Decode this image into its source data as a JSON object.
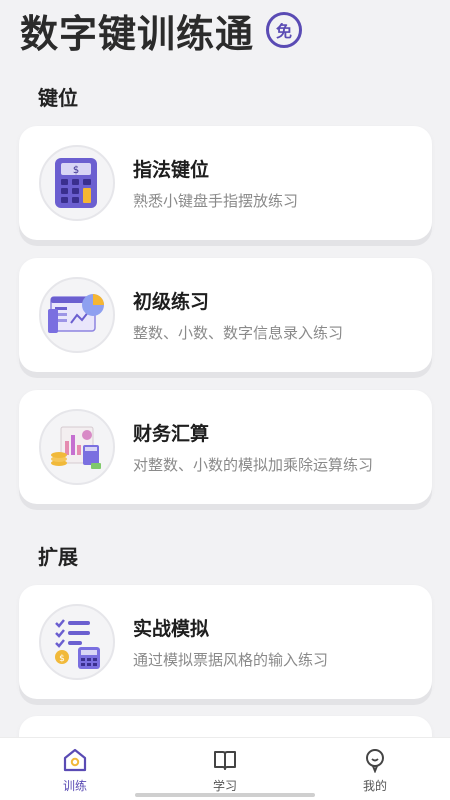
{
  "header": {
    "title": "数字键训练通",
    "badge": "免"
  },
  "sections": [
    {
      "title": "键位"
    },
    {
      "title": "扩展"
    }
  ],
  "cards": [
    {
      "title": "指法键位",
      "subtitle": "熟悉小键盘手指摆放练习",
      "icon": "calculator-icon"
    },
    {
      "title": "初级练习",
      "subtitle": "整数、小数、数字信息录入练习",
      "icon": "chart-dashboard-icon"
    },
    {
      "title": "财务汇算",
      "subtitle": "对整数、小数的模拟加乘除运算练习",
      "icon": "finance-coins-icon"
    },
    {
      "title": "实战模拟",
      "subtitle": "通过模拟票据风格的输入练习",
      "icon": "checklist-calculator-icon"
    }
  ],
  "tabs": [
    {
      "label": "训练",
      "icon": "home-icon",
      "active": true
    },
    {
      "label": "学习",
      "icon": "book-icon",
      "active": false
    },
    {
      "label": "我的",
      "icon": "profile-icon",
      "active": false
    }
  ],
  "colors": {
    "accent": "#5a4bb4",
    "background": "#f2f2f4",
    "card": "#ffffff"
  }
}
